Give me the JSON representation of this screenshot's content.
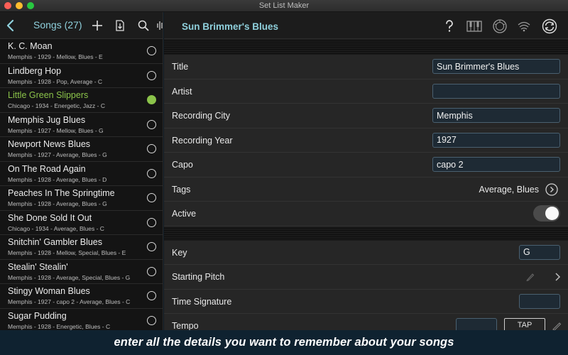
{
  "window": {
    "title": "Set List Maker"
  },
  "left": {
    "title": "Songs (27)",
    "icons": [
      "back-icon",
      "add-icon",
      "import-icon",
      "search-icon",
      "waveform-icon"
    ],
    "songs": [
      {
        "name": "K. C. Moan",
        "meta": "Memphis - 1929 - Mellow, Blues - E",
        "selected": false
      },
      {
        "name": "Lindberg Hop",
        "meta": "Memphis - 1928 - Pop, Average - C",
        "selected": false
      },
      {
        "name": "Little Green Slippers",
        "meta": "Chicago - 1934 - Energetic, Jazz - C",
        "selected": true
      },
      {
        "name": "Memphis Jug Blues",
        "meta": "Memphis - 1927 - Mellow, Blues - G",
        "selected": false
      },
      {
        "name": "Newport News Blues",
        "meta": "Memphis - 1927 - Average, Blues - G",
        "selected": false
      },
      {
        "name": "On The Road Again",
        "meta": "Memphis - 1928 - Average, Blues - D",
        "selected": false
      },
      {
        "name": "Peaches In The Springtime",
        "meta": "Memphis - 1928 - Average, Blues - G",
        "selected": false
      },
      {
        "name": "She Done Sold It Out",
        "meta": "Chicago - 1934 - Average, Blues - C",
        "selected": false
      },
      {
        "name": "Snitchin' Gambler Blues",
        "meta": "Memphis - 1928 - Mellow, Special, Blues - E",
        "selected": false
      },
      {
        "name": "Stealin' Stealin'",
        "meta": "Memphis - 1928 - Average, Special, Blues - G",
        "selected": false
      },
      {
        "name": "Stingy Woman Blues",
        "meta": "Memphis - 1927 - capo 2 - Average, Blues - C",
        "selected": false
      },
      {
        "name": "Sugar Pudding",
        "meta": "Memphis - 1928 - Energetic, Blues - C",
        "selected": false
      }
    ]
  },
  "detail": {
    "title": "Sun Brimmer's Blues",
    "toolbar_icons": [
      "help-icon",
      "keyboard-icon",
      "pitch-pipe-icon",
      "metronome-icon",
      "sync-icon"
    ],
    "fields": {
      "title_label": "Title",
      "title_value": "Sun Brimmer's Blues",
      "artist_label": "Artist",
      "artist_value": "",
      "city_label": "Recording City",
      "city_value": "Memphis",
      "year_label": "Recording Year",
      "year_value": "1927",
      "capo_label": "Capo",
      "capo_value": "capo 2",
      "tags_label": "Tags",
      "tags_value": "Average, Blues",
      "active_label": "Active",
      "active_value": true,
      "key_label": "Key",
      "key_value": "G",
      "pitch_label": "Starting Pitch",
      "timesig_label": "Time Signature",
      "timesig_value": "",
      "tempo_label": "Tempo",
      "tempo_value": "",
      "tap_label": "TAP"
    }
  },
  "caption": "enter all the details you want to remember about your songs",
  "colors": {
    "accent": "#8fd0dc",
    "selected": "#8bc34a"
  }
}
